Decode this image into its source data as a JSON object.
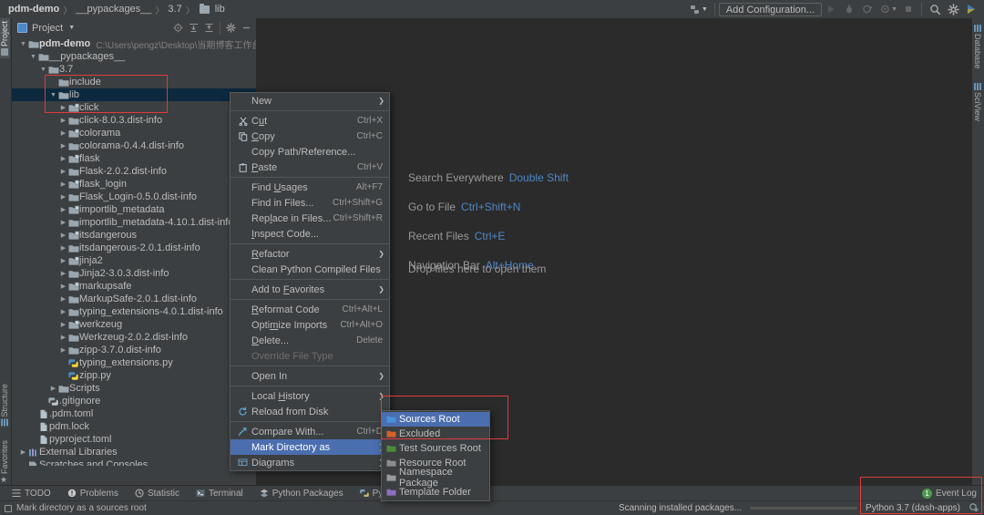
{
  "breadcrumbs": [
    {
      "label": "pdm-demo",
      "bold": true,
      "icon": null
    },
    {
      "label": "__pypackages__",
      "bold": false,
      "icon": null
    },
    {
      "label": "3.7",
      "bold": false,
      "icon": null
    },
    {
      "label": "lib",
      "bold": false,
      "icon": "folder-icon"
    }
  ],
  "toolbar": {
    "add_configuration": "Add Configuration...",
    "icons": [
      "project-structure-icon",
      "run-icon",
      "debug-icon",
      "run-coverage-icon",
      "profile-icon",
      "stop-icon",
      "search-icon",
      "settings-icon",
      "updates-icon"
    ]
  },
  "left_strip": {
    "tabs": [
      {
        "label": "Project",
        "selected": true
      },
      {
        "label": "Structure",
        "selected": false
      },
      {
        "label": "Favorites",
        "selected": false
      }
    ]
  },
  "right_strip": {
    "tabs": [
      {
        "label": "Database"
      },
      {
        "label": "SciView"
      }
    ]
  },
  "project_panel": {
    "title": "Project",
    "buttons": [
      "locate-icon",
      "expand-all-icon",
      "collapse-all-icon",
      "settings-icon",
      "hide-icon"
    ],
    "tree": [
      {
        "indent": 0,
        "arrow": "down",
        "icon": "folder-module",
        "label": "pdm-demo",
        "bold": true,
        "path": "C:\\Users\\pengz\\Desktop\\当期博客工作台\\pd",
        "selected": false
      },
      {
        "indent": 1,
        "arrow": "down",
        "icon": "folder",
        "label": "__pypackages__",
        "selected": false
      },
      {
        "indent": 2,
        "arrow": "down",
        "icon": "folder",
        "label": "3.7",
        "selected": false
      },
      {
        "indent": 3,
        "arrow": "none",
        "icon": "folder",
        "label": "include",
        "selected": false
      },
      {
        "indent": 3,
        "arrow": "down",
        "icon": "folder",
        "label": "lib",
        "selected": true
      },
      {
        "indent": 4,
        "arrow": "right",
        "icon": "folder-package",
        "label": "click",
        "selected": false
      },
      {
        "indent": 4,
        "arrow": "right",
        "icon": "folder",
        "label": "click-8.0.3.dist-info",
        "selected": false
      },
      {
        "indent": 4,
        "arrow": "right",
        "icon": "folder-package",
        "label": "colorama",
        "selected": false
      },
      {
        "indent": 4,
        "arrow": "right",
        "icon": "folder",
        "label": "colorama-0.4.4.dist-info",
        "selected": false
      },
      {
        "indent": 4,
        "arrow": "right",
        "icon": "folder-package",
        "label": "flask",
        "selected": false
      },
      {
        "indent": 4,
        "arrow": "right",
        "icon": "folder",
        "label": "Flask-2.0.2.dist-info",
        "selected": false
      },
      {
        "indent": 4,
        "arrow": "right",
        "icon": "folder-package",
        "label": "flask_login",
        "selected": false
      },
      {
        "indent": 4,
        "arrow": "right",
        "icon": "folder",
        "label": "Flask_Login-0.5.0.dist-info",
        "selected": false
      },
      {
        "indent": 4,
        "arrow": "right",
        "icon": "folder-package",
        "label": "importlib_metadata",
        "selected": false
      },
      {
        "indent": 4,
        "arrow": "right",
        "icon": "folder",
        "label": "importlib_metadata-4.10.1.dist-info",
        "selected": false
      },
      {
        "indent": 4,
        "arrow": "right",
        "icon": "folder-package",
        "label": "itsdangerous",
        "selected": false
      },
      {
        "indent": 4,
        "arrow": "right",
        "icon": "folder",
        "label": "itsdangerous-2.0.1.dist-info",
        "selected": false
      },
      {
        "indent": 4,
        "arrow": "right",
        "icon": "folder-package",
        "label": "jinja2",
        "selected": false
      },
      {
        "indent": 4,
        "arrow": "right",
        "icon": "folder",
        "label": "Jinja2-3.0.3.dist-info",
        "selected": false
      },
      {
        "indent": 4,
        "arrow": "right",
        "icon": "folder-package",
        "label": "markupsafe",
        "selected": false
      },
      {
        "indent": 4,
        "arrow": "right",
        "icon": "folder",
        "label": "MarkupSafe-2.0.1.dist-info",
        "selected": false
      },
      {
        "indent": 4,
        "arrow": "right",
        "icon": "folder",
        "label": "typing_extensions-4.0.1.dist-info",
        "selected": false
      },
      {
        "indent": 4,
        "arrow": "right",
        "icon": "folder-package",
        "label": "werkzeug",
        "selected": false
      },
      {
        "indent": 4,
        "arrow": "right",
        "icon": "folder",
        "label": "Werkzeug-2.0.2.dist-info",
        "selected": false
      },
      {
        "indent": 4,
        "arrow": "right",
        "icon": "folder",
        "label": "zipp-3.7.0.dist-info",
        "selected": false
      },
      {
        "indent": 4,
        "arrow": "none",
        "icon": "python-file",
        "label": "typing_extensions.py",
        "selected": false
      },
      {
        "indent": 4,
        "arrow": "none",
        "icon": "python-file",
        "label": "zipp.py",
        "selected": false
      },
      {
        "indent": 3,
        "arrow": "right",
        "icon": "folder",
        "label": "Scripts",
        "selected": false
      },
      {
        "indent": 2,
        "arrow": "none",
        "icon": "gitignore-file",
        "label": ".gitignore",
        "selected": false
      },
      {
        "indent": 1,
        "arrow": "none",
        "icon": "toml-file",
        "label": ".pdm.toml",
        "selected": false
      },
      {
        "indent": 1,
        "arrow": "none",
        "icon": "toml-file",
        "label": "pdm.lock",
        "selected": false
      },
      {
        "indent": 1,
        "arrow": "none",
        "icon": "toml-file",
        "label": "pyproject.toml",
        "selected": false
      },
      {
        "indent": 0,
        "arrow": "right",
        "icon": "libraries-icon",
        "label": "External Libraries",
        "selected": false
      },
      {
        "indent": 0,
        "arrow": "none",
        "icon": "scratches-icon",
        "label": "Scratches and Consoles",
        "selected": false
      }
    ]
  },
  "editor": {
    "hints": [
      {
        "label": "Search Everywhere",
        "key": "Double Shift"
      },
      {
        "label": "Go to File",
        "key": "Ctrl+Shift+N"
      },
      {
        "label": "Recent Files",
        "key": "Ctrl+E"
      },
      {
        "label": "Navigation Bar",
        "key": "Alt+Home"
      }
    ],
    "drop_text": "Drop files here to open them"
  },
  "context_menu": {
    "items": [
      {
        "label": "New",
        "accel": "",
        "icon": null,
        "submenu": true,
        "separator_after": true
      },
      {
        "label": "Cut",
        "accel": "Ctrl+X",
        "icon": "cut-icon",
        "underline": 1
      },
      {
        "label": "Copy",
        "accel": "Ctrl+C",
        "icon": "copy-icon",
        "underline": 0
      },
      {
        "label": "Copy Path/Reference...",
        "accel": "",
        "icon": null
      },
      {
        "label": "Paste",
        "accel": "Ctrl+V",
        "icon": "paste-icon",
        "underline": 0,
        "separator_after": true
      },
      {
        "label": "Find Usages",
        "accel": "Alt+F7",
        "icon": null,
        "underline": 5
      },
      {
        "label": "Find in Files...",
        "accel": "Ctrl+Shift+G",
        "icon": null
      },
      {
        "label": "Replace in Files...",
        "accel": "Ctrl+Shift+R",
        "icon": null,
        "underline": 3
      },
      {
        "label": "Inspect Code...",
        "accel": "",
        "icon": null,
        "underline": 0,
        "separator_after": true
      },
      {
        "label": "Refactor",
        "accel": "",
        "icon": null,
        "submenu": true,
        "underline": 0
      },
      {
        "label": "Clean Python Compiled Files",
        "accel": "",
        "icon": null,
        "separator_after": true
      },
      {
        "label": "Add to Favorites",
        "accel": "",
        "icon": null,
        "submenu": true,
        "underline": 7,
        "separator_after": true
      },
      {
        "label": "Reformat Code",
        "accel": "Ctrl+Alt+L",
        "icon": null,
        "underline": 0
      },
      {
        "label": "Optimize Imports",
        "accel": "Ctrl+Alt+O",
        "icon": null,
        "underline": 4
      },
      {
        "label": "Delete...",
        "accel": "Delete",
        "icon": null,
        "underline": 0
      },
      {
        "label": "Override File Type",
        "accel": "",
        "icon": null,
        "disabled": true,
        "separator_after": true
      },
      {
        "label": "Open In",
        "accel": "",
        "icon": null,
        "submenu": true,
        "separator_after": true
      },
      {
        "label": "Local History",
        "accel": "",
        "icon": null,
        "submenu": true,
        "underline": 6
      },
      {
        "label": "Reload from Disk",
        "accel": "",
        "icon": "reload-icon",
        "separator_after": true
      },
      {
        "label": "Compare With...",
        "accel": "Ctrl+D",
        "icon": "compare-icon"
      },
      {
        "label": "Mark Directory as",
        "accel": "",
        "icon": null,
        "submenu": true,
        "selected": true
      },
      {
        "label": "Diagrams",
        "accel": "",
        "icon": "diagrams-icon",
        "submenu": true
      }
    ]
  },
  "submenu": {
    "items": [
      {
        "label": "Sources Root",
        "color": "#4a90d9",
        "selected": true
      },
      {
        "label": "Excluded",
        "color": "#d2622a",
        "selected": false
      },
      {
        "label": "Test Sources Root",
        "color": "#4f8a3c",
        "selected": false
      },
      {
        "label": "Resource Root",
        "color": "#8c8c8c",
        "selected": false
      },
      {
        "label": "Namespace Package",
        "color": "#9a9a9a",
        "selected": false
      },
      {
        "label": "Template Folder",
        "color": "#8d6fbf",
        "selected": false
      }
    ]
  },
  "tool_windows": {
    "items": [
      {
        "label": "TODO",
        "icon": "todo-icon"
      },
      {
        "label": "Problems",
        "icon": "problems-icon"
      },
      {
        "label": "Statistic",
        "icon": "statistic-icon"
      },
      {
        "label": "Terminal",
        "icon": "terminal-icon"
      },
      {
        "label": "Python Packages",
        "icon": "packages-icon"
      },
      {
        "label": "Python Console",
        "icon": "console-icon"
      }
    ]
  },
  "status_bar": {
    "message": "Mark directory as a sources root",
    "scanning": "Scanning installed packages...",
    "interpreter": "Python 3.7 (dash-apps)",
    "event_log": "Event Log",
    "event_count": "1"
  },
  "colors": {
    "accent": "#4b6eaf",
    "selection": "#0d293e",
    "annotation": "#e03b3b",
    "link": "#4e87c7"
  }
}
